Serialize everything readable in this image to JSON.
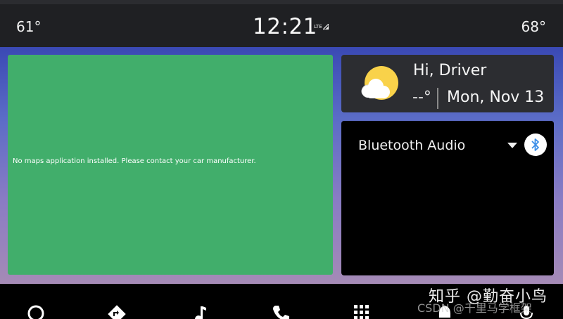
{
  "status_bar": {
    "temp_left": "61°",
    "clock": "12:21",
    "network": "LTE",
    "temp_right": "68°"
  },
  "map": {
    "message": "No maps application installed. Please contact your car manufacturer."
  },
  "greeting": {
    "hello": "Hi, Driver",
    "temperature": "--°",
    "date": "Mon, Nov 13",
    "weather_icon": "partly-cloudy-icon"
  },
  "media": {
    "source": "Bluetooth Audio",
    "dropdown_icon": "arrow-drop-down-icon",
    "bluetooth_icon": "bluetooth-icon"
  },
  "nav": {
    "items": [
      "home-icon",
      "navigation-icon",
      "music-icon",
      "phone-icon",
      "apps-icon",
      "notifications-icon",
      "mic-icon"
    ]
  },
  "watermark": {
    "zhihu": "知乎 @勤奋小鸟",
    "csdn": "CSDN @千里马学框架"
  },
  "colors": {
    "map_green": "#41ae6b",
    "card_dark": "#2c2d31",
    "sun_yellow": "#f9d24a"
  }
}
